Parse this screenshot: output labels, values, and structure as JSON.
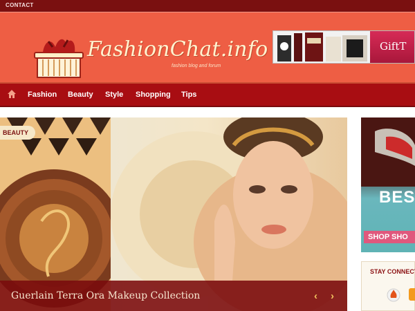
{
  "topbar": {
    "contact_label": "CONTACT"
  },
  "header": {
    "site_title": "FashionChat.info",
    "tagline": "fashion blog and forum",
    "banner_label": "GiftT"
  },
  "nav": {
    "items": [
      "Fashion",
      "Beauty",
      "Style",
      "Shopping",
      "Tips"
    ]
  },
  "slider": {
    "badge": "BEAUTY",
    "caption": "Guerlain Terra Ora Makeup Collection",
    "prev_glyph": "‹",
    "next_glyph": "›"
  },
  "ad": {
    "big_text": "BES",
    "shop_label": "SHOP SHO"
  },
  "sidebar": {
    "stay_connected": "STAY CONNECTI"
  },
  "colors": {
    "topbar": "#7a1010",
    "header": "#ee5e44",
    "nav": "#a80d12",
    "caption_bg": "#7a0a0c",
    "accent_gold": "#f2c25e"
  }
}
